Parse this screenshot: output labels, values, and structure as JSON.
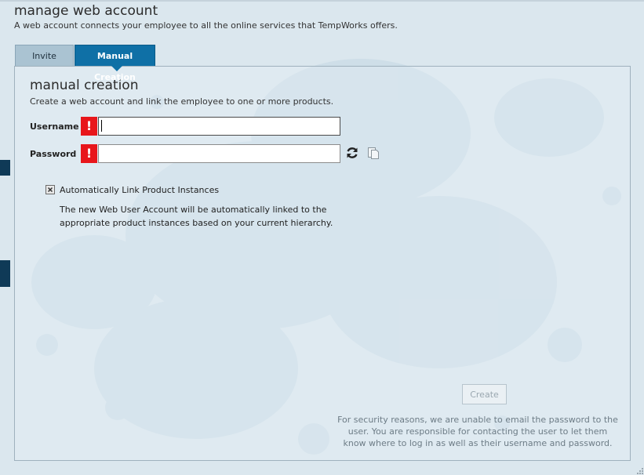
{
  "header": {
    "title": "manage web account",
    "subtitle": "A web account connects your employee to all the online services that TempWorks offers."
  },
  "tabs": [
    {
      "label": "Invite",
      "active": false
    },
    {
      "label": "Manual Creation",
      "active": true
    }
  ],
  "section": {
    "title": "manual creation",
    "subtitle": "Create a web account and link the employee to one or more products."
  },
  "form": {
    "username_label": "Username",
    "username_value": "",
    "password_label": "Password",
    "password_value": "",
    "required_marker": "!"
  },
  "auto_link": {
    "checked": true,
    "label": "Automatically Link Product Instances",
    "description": "The new Web User Account will be automatically linked to the appropriate product instances based on your current hierarchy."
  },
  "actions": {
    "create_label": "Create",
    "create_disabled": true
  },
  "security_note": "For security reasons, we are unable to email the password to the user.  You are responsible for contacting the user to let them know where to log in as well as their username and password.",
  "icons": {
    "required": "exclamation-icon",
    "generate_password": "refresh-icon",
    "copy_password": "copy-icon",
    "checkbox_mark": "x-mark-icon"
  },
  "colors": {
    "tab_active": "#0f70a6",
    "tab_inactive": "#aac3d2",
    "required_marker": "#e8161b",
    "background": "#dbe7ee"
  }
}
